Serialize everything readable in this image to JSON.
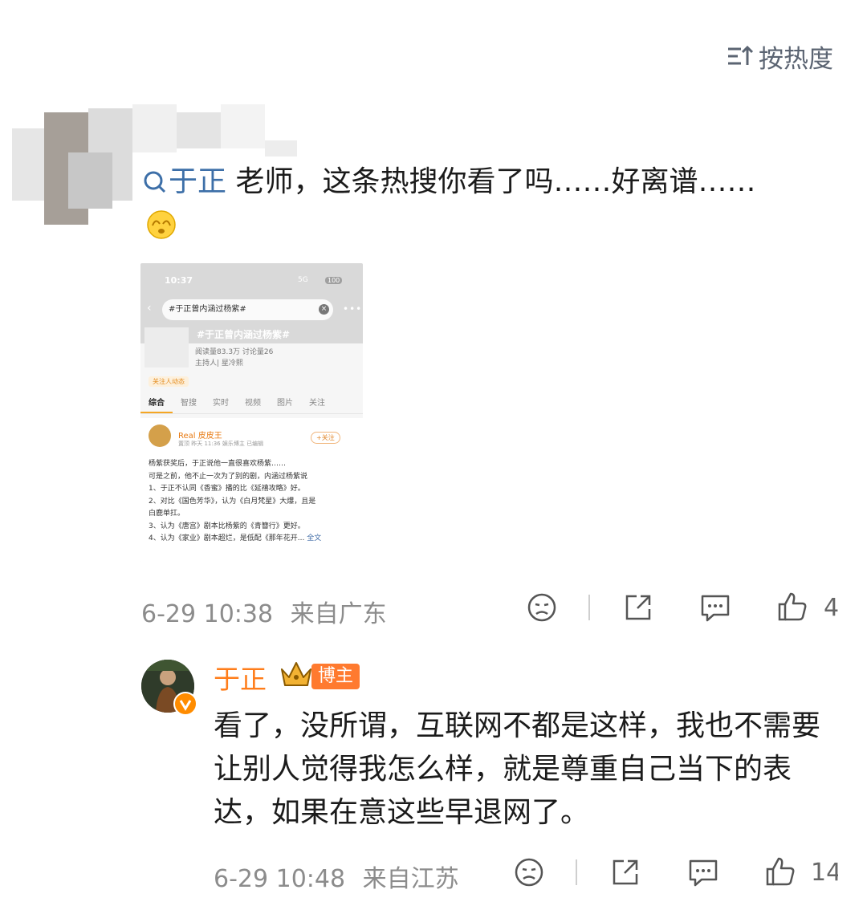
{
  "sort": {
    "label": "按热度"
  },
  "comment": {
    "mention": "于正",
    "text": " 老师，这条热搜你看了吗……好离谱……",
    "time": "6-29 10:38",
    "location": "来自广东",
    "like_count": "4",
    "embedded_screenshot": {
      "status_time": "10:37",
      "signal": "5G",
      "battery": "100",
      "search_query": "#于正曾内涵过杨紫#",
      "topic_title": "#于正曾内涵过杨紫#",
      "stats": "阅读量83.3万  讨论量26",
      "host": "主持人| 星冷熙",
      "follow_tag": "关注人动态",
      "tabs": [
        "综合",
        "智搜",
        "实时",
        "视频",
        "图片",
        "关注"
      ],
      "post_author": "Real 皮皮王",
      "post_meta": "置顶 昨天 11:36 娱乐博主 已编辑",
      "follow_button": "+关注",
      "post_lines": [
        "杨紫获奖后，于正说他一直很喜欢杨紫……",
        "可是之前，他不止一次为了别的剧，内涵过杨紫说",
        "1、于正不认同《香蜜》播的比《延禧攻略》好。",
        "2、对比《国色芳华》，认为《白月梵星》大爆，且是",
        "白鹿单扛。",
        "3、认为《唐宫》剧本比杨紫的《青簪行》更好。",
        "4、认为《家业》剧本超烂，是低配《那年花开..."
      ],
      "full_text_link": "全文"
    }
  },
  "reply": {
    "name": "于正",
    "badge": "博主",
    "text": "看了，没所谓，互联网不都是这样，我也不需要让别人觉得我怎么样，就是尊重自己当下的表达，如果在意这些早退网了。",
    "time": "6-29 10:48",
    "location": "来自江苏",
    "like_count": "14"
  },
  "colors": {
    "mention": "#3d6fa8",
    "blogger_name": "#ff7d1a",
    "badge_bg": "#ff7a2f",
    "meta": "#8c8c8c"
  }
}
